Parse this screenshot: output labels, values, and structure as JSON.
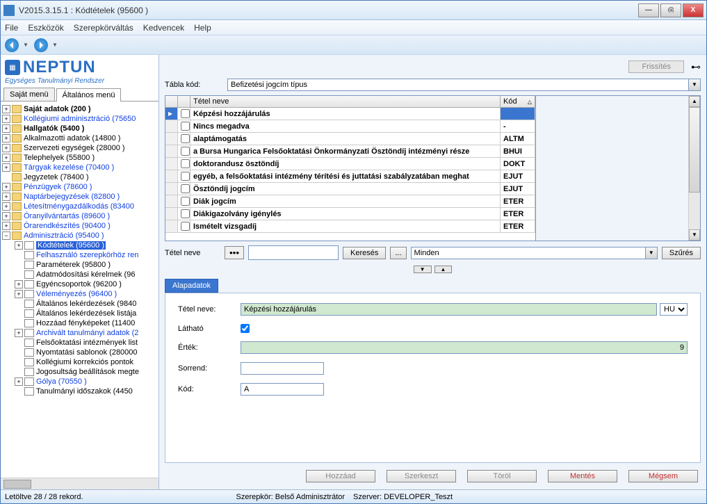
{
  "window": {
    "title": "V2015.3.15.1 : Kódtételek (95600 )"
  },
  "menu": [
    "File",
    "Eszközök",
    "Szerepkörváltás",
    "Kedvencek",
    "Help"
  ],
  "logo": {
    "text": "NEPTUN",
    "sub": "Egységes Tanulmányi Rendszer"
  },
  "left_tabs": {
    "t1": "Saját menü",
    "t2": "Általános menü"
  },
  "tree": {
    "n0": "Saját adatok (200  )",
    "n1": "Kollégiumi adminisztráció (75650",
    "n2": "Hallgatók (5400  )",
    "n3": "Alkalmazotti adatok (14800  )",
    "n4": "Szervezeti egységek (28000  )",
    "n5": "Telephelyek (55800  )",
    "n6": "Tárgyak kezelése (70400  )",
    "n7": "Jegyzetek (78400  )",
    "n8": "Pénzügyek (78600  )",
    "n9": "Naptárbejegyzések (82800  )",
    "n10": "Létesítménygazdálkodás (83400",
    "n11": "Óranyilvántartás (89600  )",
    "n12": "Órarendkészítés (90400  )",
    "n13": "Adminisztráció (95400  )",
    "c0": "Kódtételek (95600  )",
    "c1": "Felhasználó szerepkörhöz ren",
    "c2": "Paraméterek (95800  )",
    "c3": "Adatmódosítási kérelmek (96",
    "c4": "Egyéncsoportok (96200  )",
    "c5": "Véleményezés (96400  )",
    "c6": "Általános lekérdezések (9840",
    "c7": "Általános lekérdezések listája",
    "c8": "Hozzáad fényképeket (11400",
    "c9": "Archivált tanulmányi adatok (2",
    "c10": "Felsőoktatási intézmények list",
    "c11": "Nyomtatási sablonok (280000",
    "c12": "Kollégiumi korrekciós pontok",
    "c13": "Jogosultság beállítások megte",
    "c14": "Gólya (70550  )",
    "c15": "Tanulmányi időszakok (4450"
  },
  "top": {
    "refresh": "Frissítés"
  },
  "tabla": {
    "label": "Tábla kód:",
    "value": "Befizetési jogcím típus"
  },
  "grid_head": {
    "name": "Tétel neve",
    "code": "Kód"
  },
  "rows": [
    {
      "name": "Képzési hozzájárulás",
      "code": ""
    },
    {
      "name": "Nincs megadva",
      "code": "-"
    },
    {
      "name": "alaptámogatás",
      "code": "ALTM"
    },
    {
      "name": "a Bursa Hungarica Felsőoktatási Önkormányzati Ösztöndíj intézményi része",
      "code": "BHUI"
    },
    {
      "name": "doktorandusz ösztöndíj",
      "code": "DOKT"
    },
    {
      "name": "egyéb, a felsőoktatási intézmény térítési és juttatási szabályzatában meghat",
      "code": "EJUT"
    },
    {
      "name": "Ösztöndíj jogcím",
      "code": "EJUT"
    },
    {
      "name": "Diák jogcím",
      "code": "ETER"
    },
    {
      "name": "Diákigazolvány igénylés",
      "code": "ETER"
    },
    {
      "name": "Ismételt vizsgadíj",
      "code": "ETER"
    }
  ],
  "search": {
    "label": "Tétel neve",
    "btn": "Keresés",
    "all": "Minden",
    "filter": "Szűrés"
  },
  "dtab": "Alapadatok",
  "detail": {
    "lbl_name": "Tétel neve:",
    "name": "Képzési hozzájárulás",
    "lang": "HU",
    "lbl_vis": "Látható",
    "lbl_val": "Érték:",
    "val": "9",
    "lbl_ord": "Sorrend:",
    "ord": "",
    "lbl_code": "Kód:",
    "code": "A"
  },
  "btns": {
    "add": "Hozzáad",
    "edit": "Szerkeszt",
    "del": "Töröl",
    "save": "Mentés",
    "cancel": "Mégsem"
  },
  "status": {
    "left": "Letöltve 28 / 28 rekord.",
    "role_l": "Szerepkör:",
    "role": "Belső Adminisztrátor",
    "srv_l": "Szerver:",
    "srv": "DEVELOPER_Teszt"
  }
}
